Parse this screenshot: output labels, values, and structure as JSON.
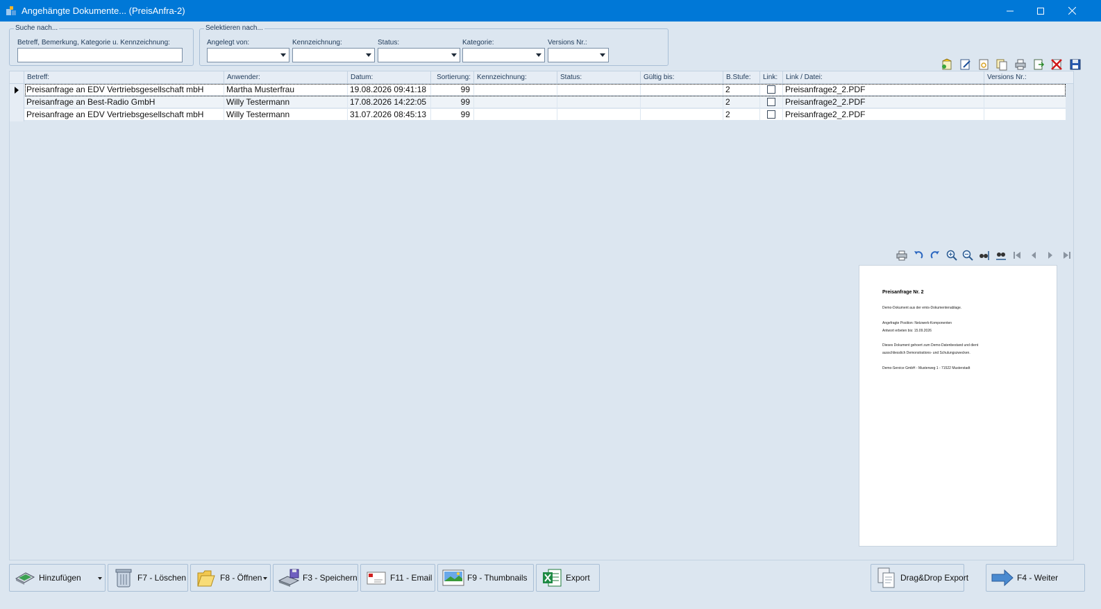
{
  "window": {
    "title": "Angehängte Dokumente... (PreisAnfra-2)"
  },
  "search": {
    "legend": "Suche nach...",
    "field_label": "Betreff, Bemerkung, Kategorie u. Kennzeichnung:",
    "value": ""
  },
  "select": {
    "legend": "Selektieren nach...",
    "filters": [
      {
        "label": "Angelegt von:",
        "value": ""
      },
      {
        "label": "Kennzeichnung:",
        "value": ""
      },
      {
        "label": "Status:",
        "value": ""
      },
      {
        "label": "Kategorie:",
        "value": ""
      },
      {
        "label": "Versions Nr.:",
        "value": ""
      }
    ]
  },
  "toolbar_icons": [
    "new-document-icon",
    "edit-icon",
    "refresh-icon",
    "copy-icon",
    "print-icon",
    "export-icon",
    "delete-icon",
    "save-icon"
  ],
  "grid": {
    "columns": [
      "Betreff:",
      "Anwender:",
      "Datum:",
      "Sortierung:",
      "Kennzeichnung:",
      "Status:",
      "Gültig bis:",
      "B.Stufe:",
      "Link:",
      "Link / Datei:",
      "Versions Nr.:"
    ],
    "rows": [
      {
        "betreff": "Preisanfrage an EDV Vertriebsgesellschaft mbH",
        "anwender": "Martha Musterfrau",
        "datum": "19.08.2026 09:41:18",
        "sortierung": "99",
        "kennzeichnung": "",
        "status": "",
        "gueltig": "",
        "bstufe": "2",
        "link": false,
        "datei": "Preisanfrage2_2.PDF",
        "version": ""
      },
      {
        "betreff": "Preisanfrage an Best-Radio GmbH",
        "anwender": "Willy Testermann",
        "datum": "17.08.2026 14:22:05",
        "sortierung": "99",
        "kennzeichnung": "",
        "status": "",
        "gueltig": "",
        "bstufe": "2",
        "link": false,
        "datei": "Preisanfrage2_2.PDF",
        "version": ""
      },
      {
        "betreff": "Preisanfrage an EDV Vertriebsgesellschaft mbH",
        "anwender": "Willy Testermann",
        "datum": "31.07.2026 08:45:13",
        "sortierung": "99",
        "kennzeichnung": "",
        "status": "",
        "gueltig": "",
        "bstufe": "2",
        "link": false,
        "datei": "Preisanfrage2_2.PDF",
        "version": ""
      }
    ]
  },
  "viewer_icons": [
    "print-icon",
    "rotate-left-icon",
    "rotate-right-icon",
    "zoom-in-icon",
    "zoom-out-icon",
    "fit-height-icon",
    "fit-width-icon",
    "first-page-icon",
    "previous-page-icon",
    "next-page-icon",
    "last-page-icon"
  ],
  "preview": {
    "title": "Preisanfrage Nr. 2",
    "lines": [
      "Demo-Dokument aus der emis-Dokumentenablage.",
      "Angefragte Position: Netzwerk-Komponenten",
      "Antwort erbeten bis: 15.09.2026",
      "Dieses Dokument gehoert zum Demo-Datenbestand und dient",
      "ausschliesslich Demonstrations- und Schulungszwecken.",
      "Demo-Service GmbH - Musterweg 1 - 71522 Musterstadt"
    ]
  },
  "buttons": {
    "add": "Hinzufügen",
    "delete": "F7 - Löschen",
    "open": "F8 - Öffnen",
    "save": "F3 - Speichern",
    "email": "F11 - Email",
    "thumbnails": "F9 - Thumbnails",
    "export": "Export",
    "dragdrop": "Drag&Drop Export",
    "next": "F4 - Weiter"
  }
}
